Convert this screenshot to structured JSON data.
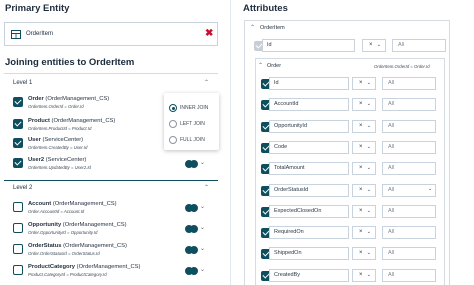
{
  "left": {
    "primary_entity_title": "Primary Entity",
    "primary_entity_name": "OrderItem",
    "joining_title": "Joining entities to OrderItem",
    "levels": [
      {
        "label": "Level 1",
        "entities": [
          {
            "name": "Order",
            "source": " (OrderManagement_CS)",
            "join": "OrderItem.OrderId = Order.Id",
            "checked": true
          },
          {
            "name": "Product",
            "source": " (OrderManagement_CS)",
            "join": "OrderItem.ProductId = Product.Id",
            "checked": true
          },
          {
            "name": "User",
            "source": " (ServiceCenter)",
            "join": "OrderItem.CreatedBy = User.Id",
            "checked": true
          },
          {
            "name": "User2",
            "source": " (ServiceCenter)",
            "join": "OrderItem.UpdatedBy = User2.Id",
            "checked": true
          }
        ]
      },
      {
        "label": "Level 2",
        "entities": [
          {
            "name": "Account",
            "source": " (OrderManagement_CS)",
            "join": "Order.AccountId = Account.Id",
            "checked": false
          },
          {
            "name": "Opportunity",
            "source": " (OrderManagement_CS)",
            "join": "Order.OpportunityId = Opportunity.Id",
            "checked": false
          },
          {
            "name": "OrderStatus",
            "source": " (OrderManagement_CS)",
            "join": "Order.OrderStatusId = OrderStatus.Id",
            "checked": false
          },
          {
            "name": "ProductCategory",
            "source": " (OrderManagement_CS)",
            "join": "Product.CategoryId = ProductCategory.Id",
            "checked": false
          }
        ]
      }
    ],
    "join_options": [
      "INNER JOIN",
      "LEFT JOIN",
      "FULL JOIN"
    ],
    "join_selected": "INNER JOIN"
  },
  "right": {
    "attributes_title": "Attributes",
    "orderitem_group": "OrderItem",
    "order_group": "Order",
    "order_join": "OrderItem.OrderId = Order.Id",
    "orderitem_row": {
      "field": "Id",
      "op": "×",
      "value": "All"
    },
    "attributes": [
      {
        "field": "Id",
        "op": "×",
        "value": "All"
      },
      {
        "field": "AccountId",
        "op": "×",
        "value": "All"
      },
      {
        "field": "OpportunityId",
        "op": "×",
        "value": "All"
      },
      {
        "field": "Code",
        "op": "×",
        "value": "All"
      },
      {
        "field": "TotalAmount",
        "op": "×",
        "value": "All"
      },
      {
        "field": "OrderStatusId",
        "op": "×",
        "value": "All"
      },
      {
        "field": "ExpectedClosedOn",
        "op": "×",
        "value": "All"
      },
      {
        "field": "RequiredOn",
        "op": "×",
        "value": "All"
      },
      {
        "field": "ShippedOn",
        "op": "×",
        "value": "All"
      },
      {
        "field": "CreatedBy",
        "op": "×",
        "value": "All"
      }
    ]
  }
}
